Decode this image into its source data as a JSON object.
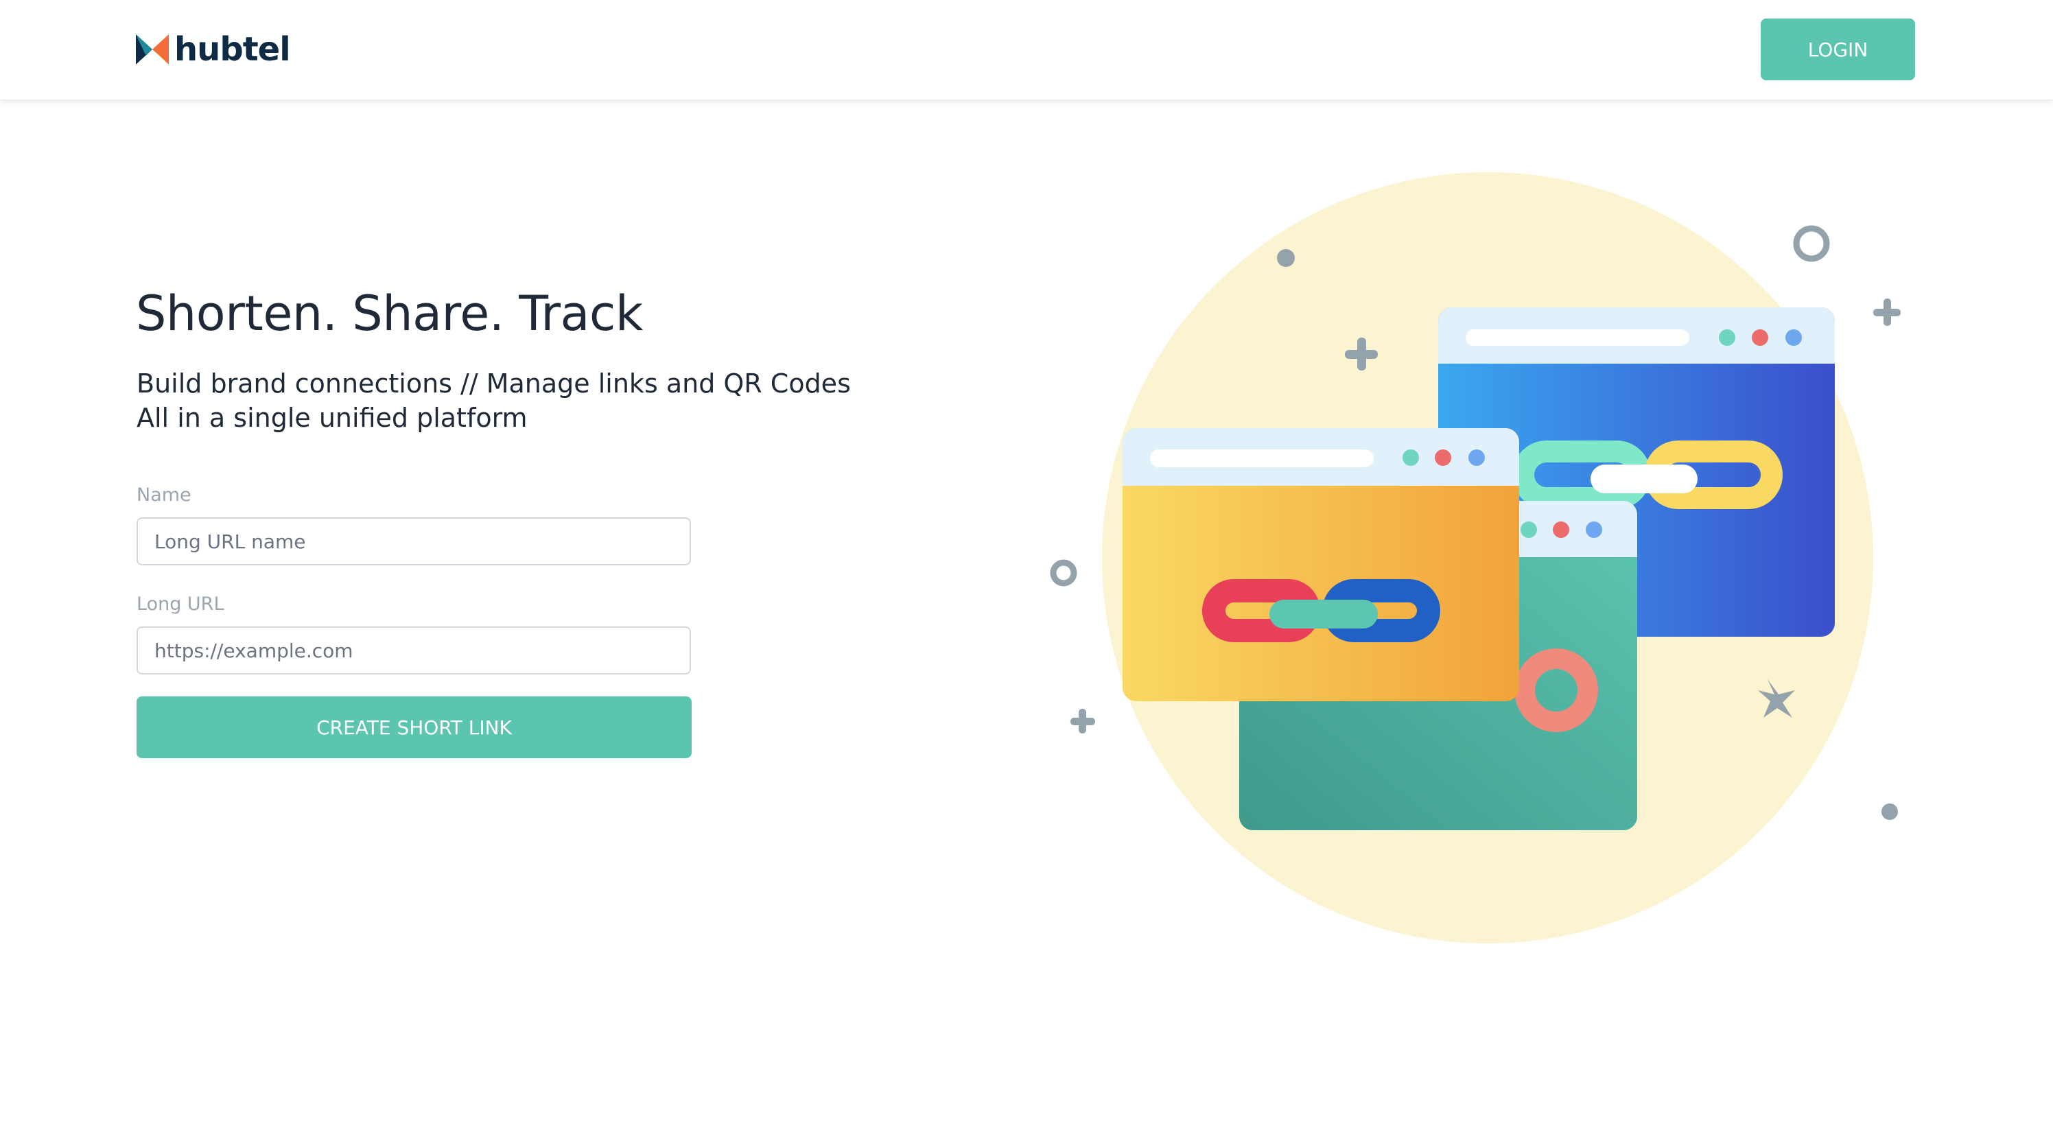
{
  "header": {
    "brand": "hubtel",
    "login_label": "LOGIN"
  },
  "hero": {
    "headline": "Shorten. Share. Track",
    "subline_1": "Build brand connections // Manage links and QR Codes",
    "subline_2": "All in a single unified platform"
  },
  "form": {
    "name_label": "Name",
    "name_placeholder": "Long URL name",
    "url_label": "Long URL",
    "url_placeholder": "https://example.com",
    "submit_label": "CREATE SHORT LINK"
  },
  "colors": {
    "accent": "#5bc5b0",
    "brand_dark": "#0f2a44",
    "circle_bg": "#fcf3d0"
  },
  "icons": {
    "logo": "hubtel-logo-icon",
    "illustration": "link-windows-illustration"
  }
}
